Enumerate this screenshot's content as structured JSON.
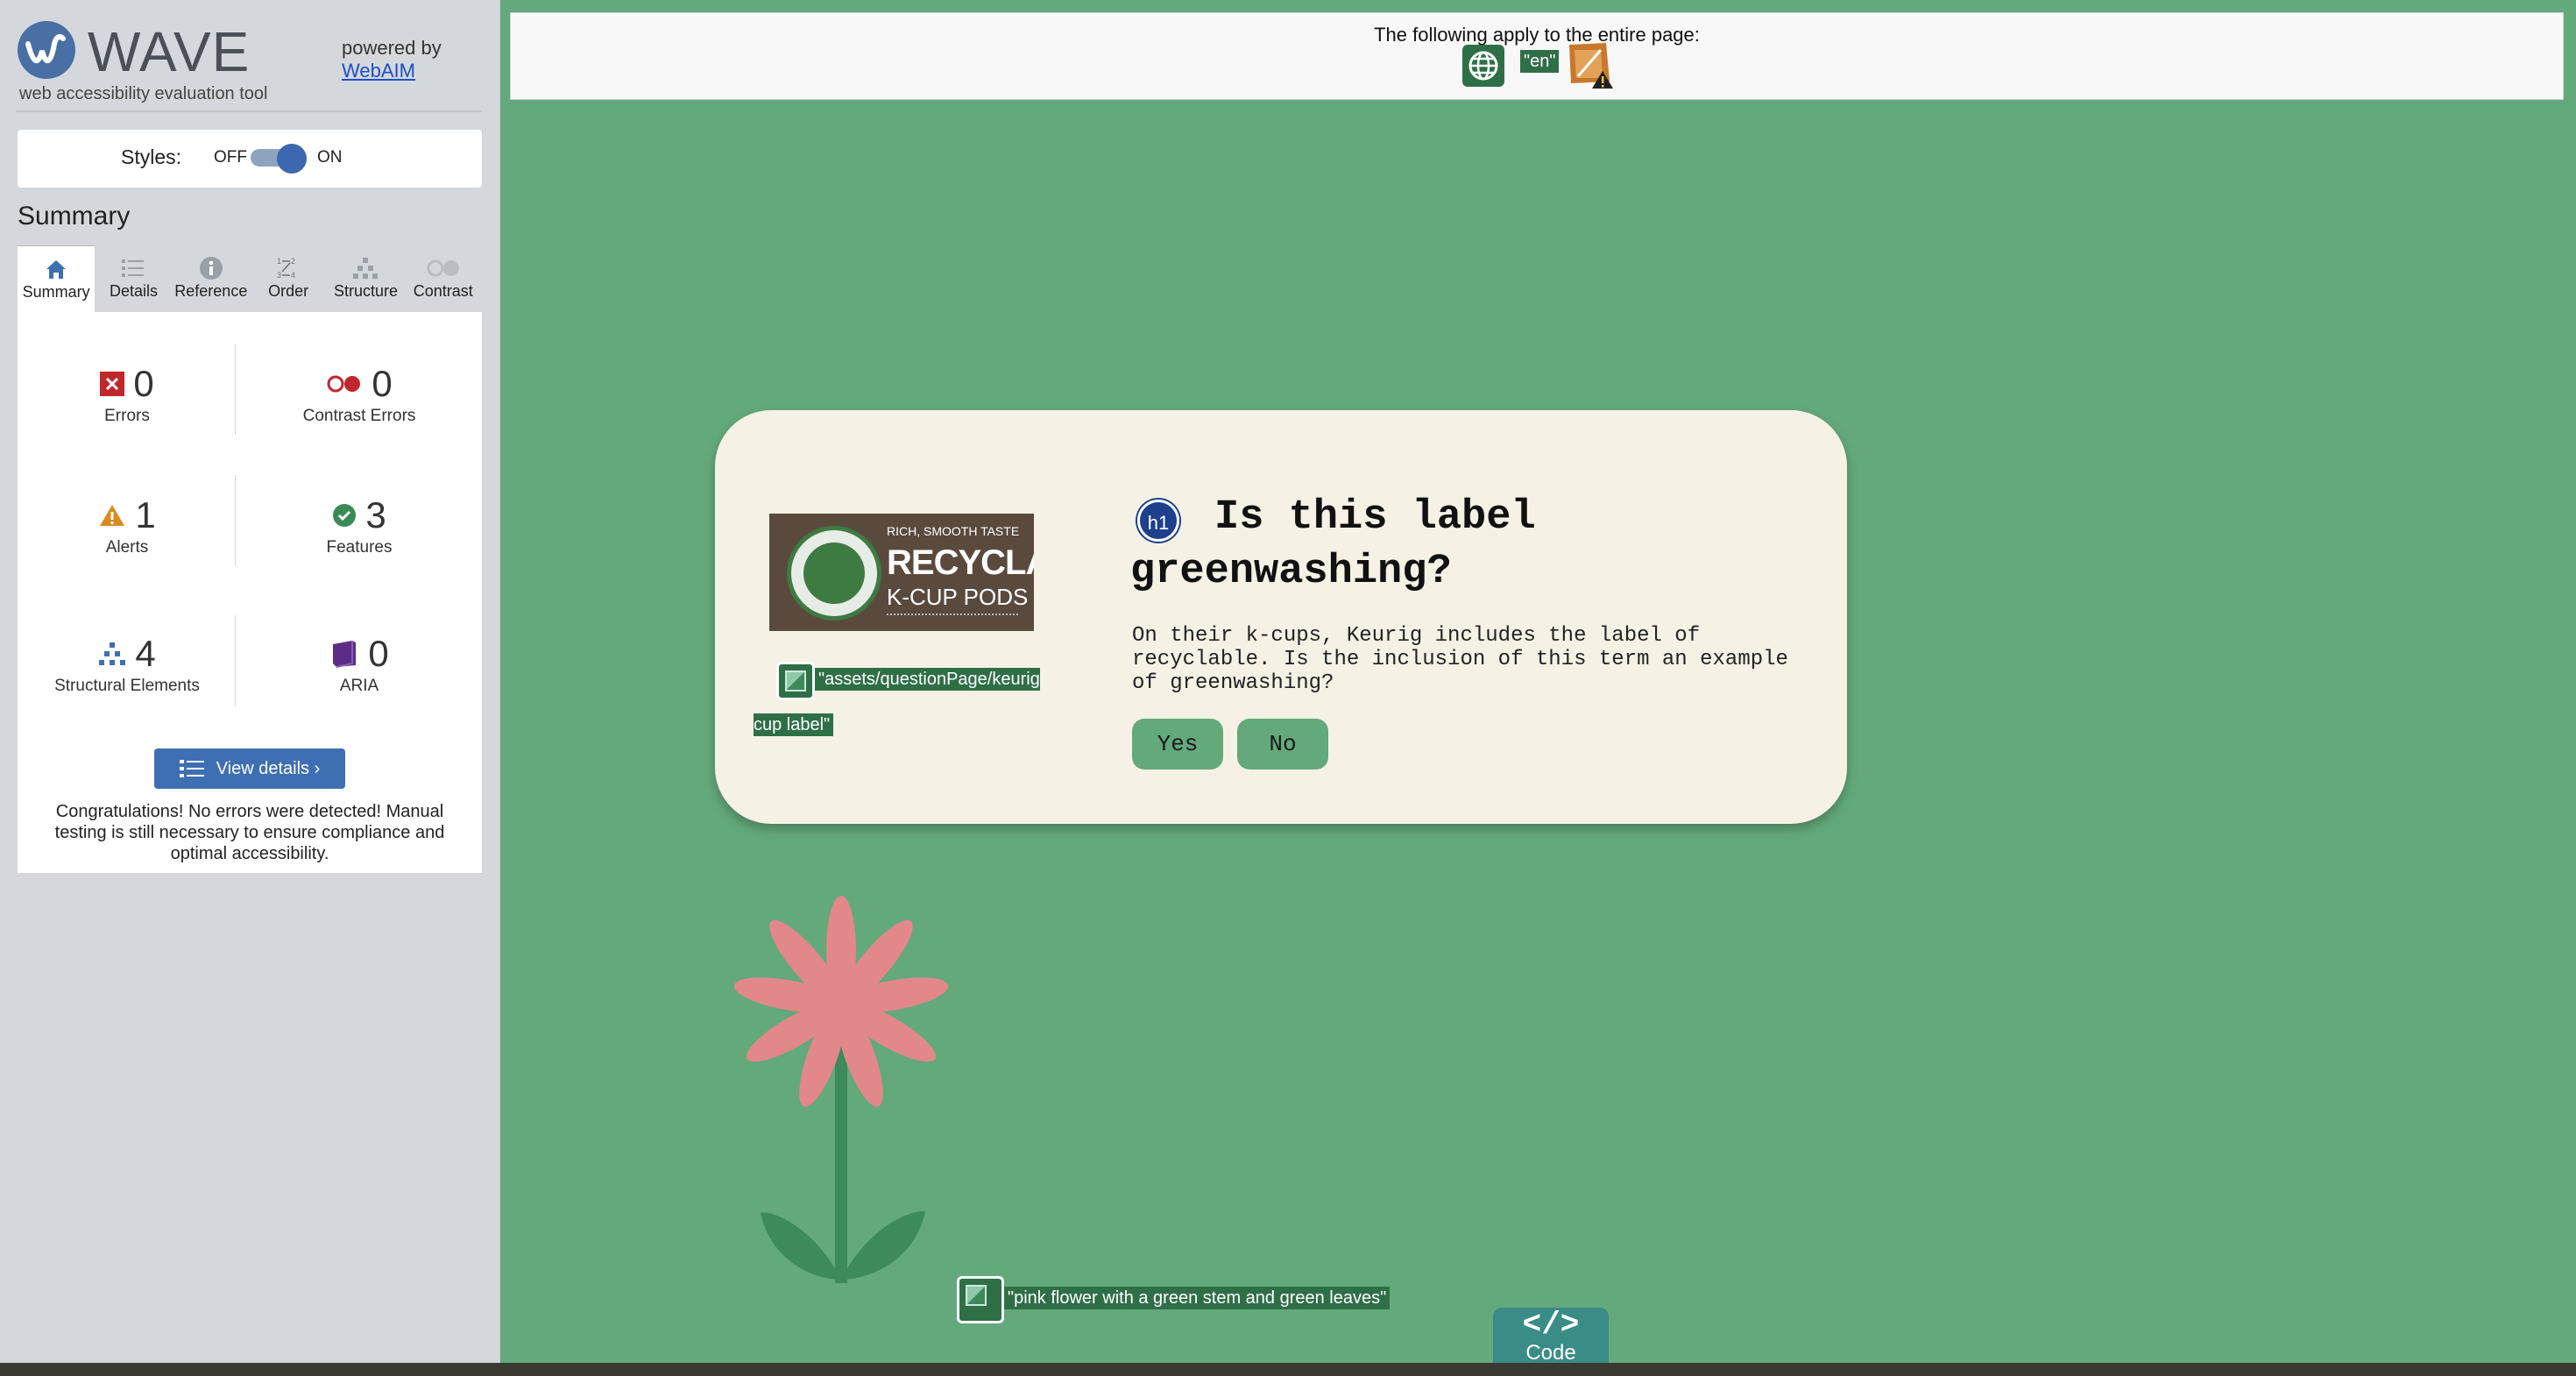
{
  "sidebar": {
    "logo": {
      "word": "WAVE",
      "tagline": "web accessibility evaluation tool"
    },
    "powered_by": {
      "text": "powered by",
      "link": "WebAIM"
    },
    "styles": {
      "label": "Styles:",
      "off": "OFF",
      "on": "ON",
      "state": "on"
    },
    "summary_heading": "Summary",
    "tabs": [
      {
        "label": "Summary",
        "icon": "home-icon",
        "active": true
      },
      {
        "label": "Details",
        "icon": "list-icon"
      },
      {
        "label": "Reference",
        "icon": "info-icon"
      },
      {
        "label": "Order",
        "icon": "order-icon"
      },
      {
        "label": "Structure",
        "icon": "structure-icon"
      },
      {
        "label": "Contrast",
        "icon": "contrast-icon"
      }
    ],
    "stats": {
      "errors": {
        "value": "0",
        "label": "Errors"
      },
      "contrast_errors": {
        "value": "0",
        "label": "Contrast Errors"
      },
      "alerts": {
        "value": "1",
        "label": "Alerts"
      },
      "features": {
        "value": "3",
        "label": "Features"
      },
      "structural": {
        "value": "4",
        "label": "Structural Elements"
      },
      "aria": {
        "value": "0",
        "label": "ARIA"
      }
    },
    "view_details": "View details ›",
    "congrats": "Congratulations! No errors were detected! Manual testing is still necessary to ensure compliance and optimal accessibility."
  },
  "banner": {
    "text": "The following apply to the entire page:",
    "lang_chip": "\"en\""
  },
  "card": {
    "image_text": {
      "line1": "RICH, SMOOTH TASTE",
      "line2": "RECYCLABLE",
      "line3": "K-CUP PODS"
    },
    "image_alt": "\"assets/questionPage/keurig cup label\"",
    "h1_badge": "h1",
    "title": "Is this label greenwashing?",
    "body": "On their k-cups, Keurig includes the label of recyclable. Is the inclusion of this term an example of greenwashing?",
    "yes": "Yes",
    "no": "No"
  },
  "flower_alt": "\"pink flower with a green stem and green leaves\"",
  "code_tab": {
    "symbol": "</>",
    "label": "Code"
  },
  "colors": {
    "accent": "#3f6fb3",
    "page_bg": "#63a97c",
    "card_bg": "#f5f2e5",
    "petal": "#e2878a",
    "stem": "#3d8a5a"
  }
}
